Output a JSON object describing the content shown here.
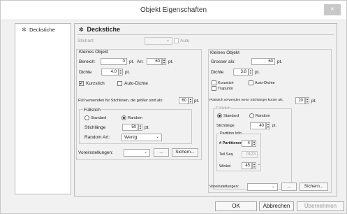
{
  "window": {
    "title": "Objekt Eigenschaften",
    "close_glyph": "×"
  },
  "sidebar": {
    "items": [
      {
        "label": "Deckstiche",
        "icon": "gear-icon"
      }
    ]
  },
  "main": {
    "title": "Deckstiche",
    "stich_label": "Stichart:",
    "auto_label": "Auto",
    "left": {
      "group_title": "Kleines Objekt",
      "bereich_label": "Bereich:",
      "bereich_value": "0",
      "bereich_unit": "pt.",
      "an_label": "An:",
      "an_value": "60",
      "an_unit": "pt.",
      "dichte_label": "Dichte",
      "dichte_value": "4.0",
      "dichte_unit": "pt.",
      "kurzstich_label": "Kurzstich",
      "kurzstich_checked": true,
      "autodichte_label": "Auto-Dichte",
      "autodichte_checked": false,
      "fill_use_label": "Füll verwenden für Stichlinien, die größer sind als:",
      "fill_use_value": "60",
      "fill_use_unit": "pt.",
      "fullstich_title": "Füllstich",
      "standard_label": "Standard",
      "random_label": "Random",
      "random_selected": true,
      "stichlange_label": "Stichlänge",
      "stichlange_value": "50",
      "stichlange_unit": "pt.",
      "random_art_label": "Random Art:",
      "random_art_value": "Wenig",
      "preset_label": "Voreinstellungen:",
      "preset_value": "",
      "dots_label": "...",
      "save_label": "Sichern..."
    },
    "right": {
      "group_title": "Kleines Objekt",
      "grosser_label": "Grosser als:",
      "grosser_value": "60",
      "grosser_unit": "pt.",
      "dichte_label": "Dichte",
      "dichte_value": "3.8",
      "dichte_unit": "pt.",
      "kurzstich_label": "Kurzstich",
      "autodichte_label": "Auto-Dichte",
      "trapunto_label": "Trapunto",
      "plattstich_label": "Plattstich verwenden wenn Stichlänger kürzer als:",
      "plattstich_value": "20",
      "plattstich_unit": "pt.",
      "fullstich_title": "Füllstich",
      "standard_label": "Standard",
      "random_label": "Random",
      "standard_selected": true,
      "stichlange_label": "Stichlänge",
      "stichlange_value": "40",
      "stichlange_unit": "pt.",
      "partition_title": "Partition Info",
      "partitionen_label": "# Partitionen",
      "partitionen_value": "4",
      "teilseq_label": "Teil Seq",
      "teilseq_value": "0123",
      "winkel_label": "Winkel",
      "winkel_value": "45",
      "winkel_unit": "°",
      "preset_label": "Voreinstellungen:",
      "preset_value": "",
      "dots_label": "...",
      "save_label": "Sichern..."
    }
  },
  "footer": {
    "ok_label": "OK",
    "cancel_label": "Abbrechen",
    "apply_label": "Übernehmen"
  }
}
